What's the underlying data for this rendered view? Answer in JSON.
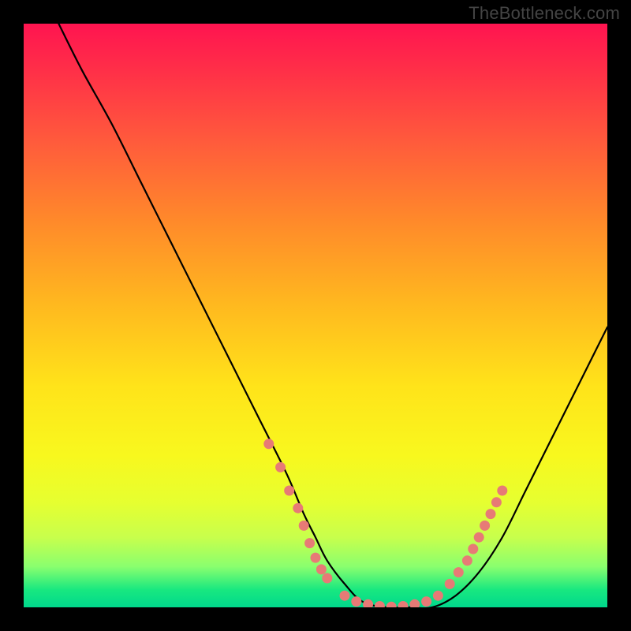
{
  "watermark": "TheBottleneck.com",
  "chart_data": {
    "type": "line",
    "title": "",
    "xlabel": "",
    "ylabel": "",
    "xlim": [
      0,
      100
    ],
    "ylim": [
      0,
      100
    ],
    "gradient_stops": [
      {
        "pos": 0,
        "color": "#ff1450"
      },
      {
        "pos": 8,
        "color": "#ff2f48"
      },
      {
        "pos": 20,
        "color": "#ff5a3c"
      },
      {
        "pos": 34,
        "color": "#ff8a2a"
      },
      {
        "pos": 48,
        "color": "#ffb81f"
      },
      {
        "pos": 62,
        "color": "#ffe31a"
      },
      {
        "pos": 74,
        "color": "#f8f81e"
      },
      {
        "pos": 82,
        "color": "#e6ff30"
      },
      {
        "pos": 88,
        "color": "#c8ff4c"
      },
      {
        "pos": 93,
        "color": "#8aff6e"
      },
      {
        "pos": 97,
        "color": "#18e880"
      },
      {
        "pos": 100,
        "color": "#00d88c"
      }
    ],
    "series": [
      {
        "name": "bottleneck-curve",
        "x": [
          6,
          10,
          15,
          20,
          25,
          30,
          35,
          40,
          45,
          48,
          50,
          52,
          55,
          58,
          62,
          66,
          70,
          74,
          78,
          82,
          86,
          90,
          94,
          98,
          100
        ],
        "y": [
          100,
          92,
          83,
          73,
          63,
          53,
          43,
          33,
          23,
          16,
          12,
          8,
          4,
          1,
          0,
          0,
          0,
          2,
          6,
          12,
          20,
          28,
          36,
          44,
          48
        ]
      }
    ],
    "markers": {
      "name": "highlighted-points",
      "color": "#e77a76",
      "points": [
        {
          "x": 42,
          "y": 28
        },
        {
          "x": 44,
          "y": 24
        },
        {
          "x": 45.5,
          "y": 20
        },
        {
          "x": 47,
          "y": 17
        },
        {
          "x": 48,
          "y": 14
        },
        {
          "x": 49,
          "y": 11
        },
        {
          "x": 50,
          "y": 8.5
        },
        {
          "x": 51,
          "y": 6.5
        },
        {
          "x": 52,
          "y": 5
        },
        {
          "x": 55,
          "y": 2
        },
        {
          "x": 57,
          "y": 1
        },
        {
          "x": 59,
          "y": 0.5
        },
        {
          "x": 61,
          "y": 0.2
        },
        {
          "x": 63,
          "y": 0.1
        },
        {
          "x": 65,
          "y": 0.2
        },
        {
          "x": 67,
          "y": 0.5
        },
        {
          "x": 69,
          "y": 1
        },
        {
          "x": 71,
          "y": 2
        },
        {
          "x": 73,
          "y": 4
        },
        {
          "x": 74.5,
          "y": 6
        },
        {
          "x": 76,
          "y": 8
        },
        {
          "x": 77,
          "y": 10
        },
        {
          "x": 78,
          "y": 12
        },
        {
          "x": 79,
          "y": 14
        },
        {
          "x": 80,
          "y": 16
        },
        {
          "x": 81,
          "y": 18
        },
        {
          "x": 82,
          "y": 20
        }
      ]
    }
  }
}
